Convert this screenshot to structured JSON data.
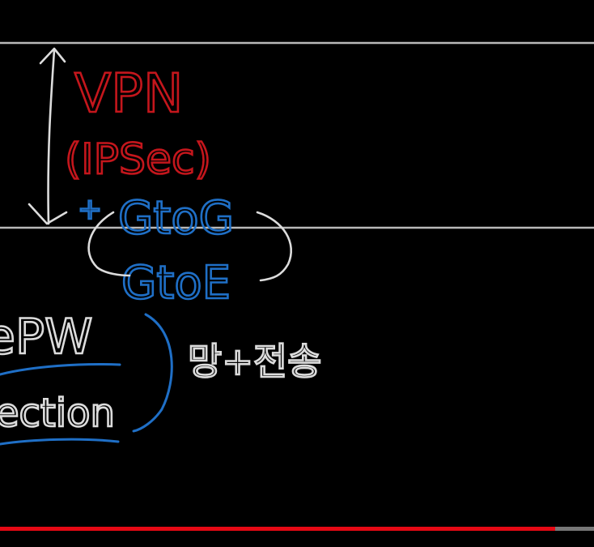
{
  "whiteboard": {
    "annotations": {
      "vpn": "VPN",
      "ipsec": "(IPSec)",
      "plus": "+",
      "gtog": "GtoG",
      "gtoe": "GtoE",
      "pw": "ePW",
      "section": "ection",
      "korean_note": "망+전송"
    },
    "colors": {
      "background": "#000000",
      "red_ink": "#c4161c",
      "blue_ink": "#1f6fc6",
      "white_ink": "#dcdcdc",
      "guide_line": "#b9b9b9"
    }
  },
  "player": {
    "progress": 0.935,
    "progress_color": "#e50914",
    "track_color": "#777777"
  }
}
